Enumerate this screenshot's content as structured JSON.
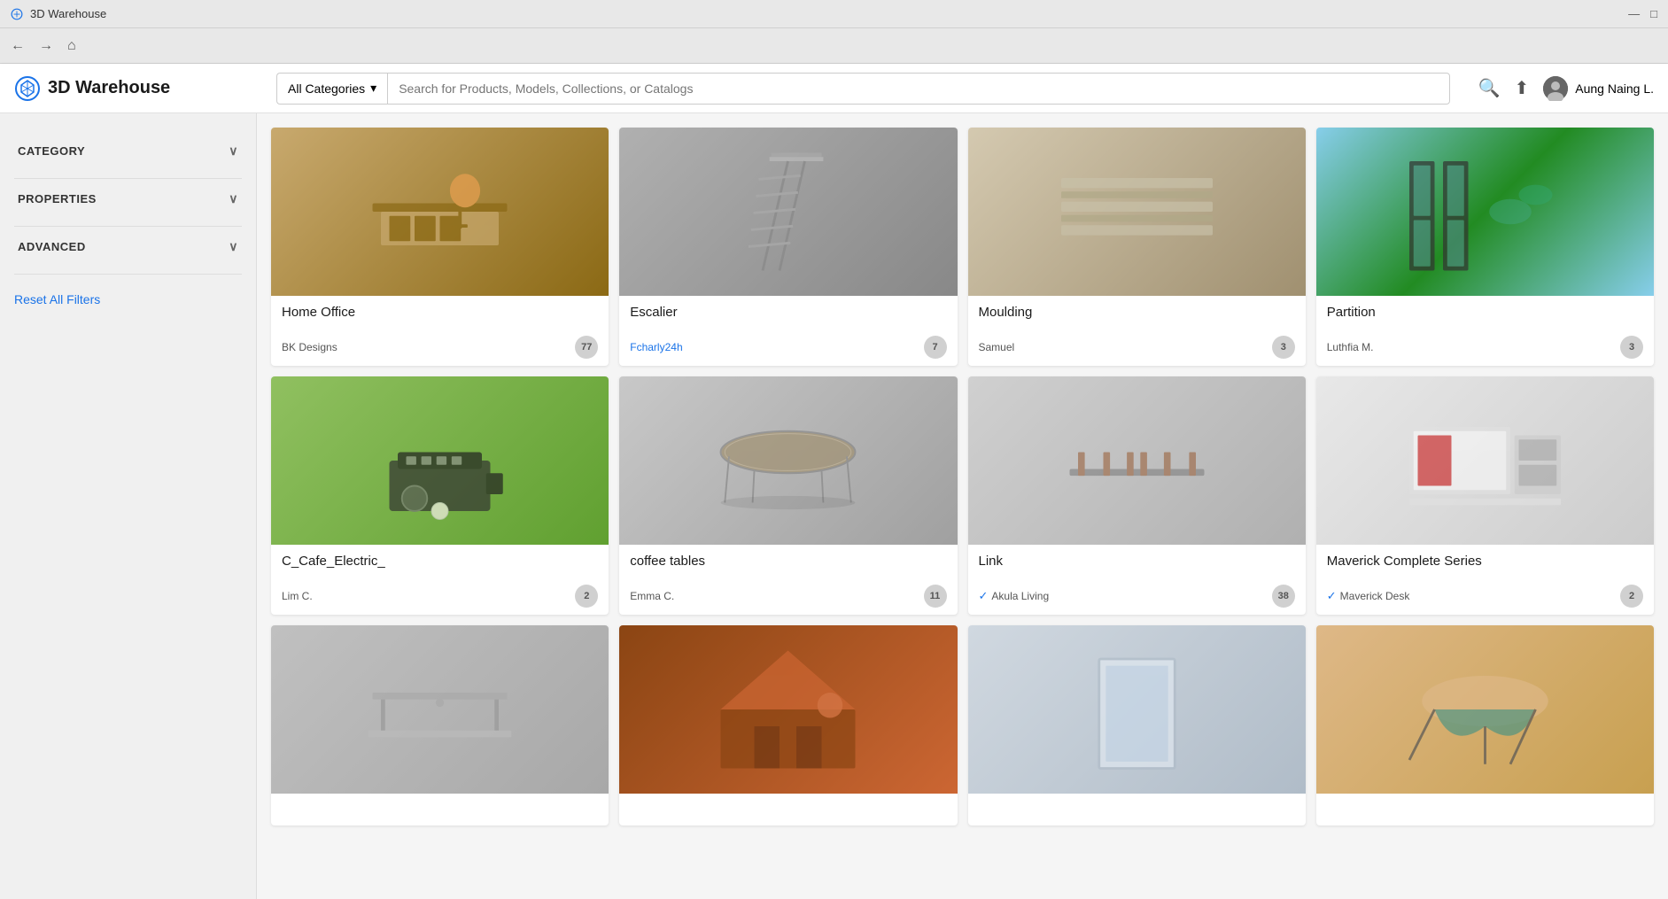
{
  "titlebar": {
    "title": "3D Warehouse",
    "min_btn": "—",
    "max_btn": "□"
  },
  "navbar": {
    "back": "←",
    "forward": "→",
    "home": "⌂"
  },
  "header": {
    "logo_text": "3D Warehouse",
    "category_btn": "All Categories",
    "search_placeholder": "Search for Products, Models, Collections, or Catalogs",
    "user_name": "Aung Naing L."
  },
  "sidebar": {
    "category_label": "CATEGORY",
    "properties_label": "PROPERTIES",
    "advanced_label": "ADVANCED",
    "reset_label": "Reset All Filters"
  },
  "grid": {
    "cards": [
      {
        "id": "home-office",
        "title": "Home Office",
        "author": "BK Designs",
        "count": "77",
        "verified": false,
        "verified_by": "",
        "img_class": "img-home-office"
      },
      {
        "id": "escalier",
        "title": "Escalier",
        "author": "Fcharly24h",
        "author_link": true,
        "count": "7",
        "verified": false,
        "verified_by": "",
        "img_class": "img-escalier"
      },
      {
        "id": "moulding",
        "title": "Moulding",
        "author": "Samuel",
        "count": "3",
        "verified": false,
        "verified_by": "",
        "img_class": "img-moulding"
      },
      {
        "id": "partition",
        "title": "Partition",
        "author": "Luthfia M.",
        "count": "3",
        "verified": false,
        "verified_by": "",
        "img_class": "img-partition"
      },
      {
        "id": "cafe-electric",
        "title": "C_Cafe_Electric_",
        "author": "Lim C.",
        "count": "2",
        "verified": false,
        "verified_by": "",
        "img_class": "img-cafe"
      },
      {
        "id": "coffee-tables",
        "title": "coffee tables",
        "author": "Emma C.",
        "count": "11",
        "verified": false,
        "verified_by": "",
        "img_class": "img-coffee"
      },
      {
        "id": "link",
        "title": "Link",
        "author": "Akula Living",
        "count": "38",
        "verified": true,
        "verified_by": "Akula Living",
        "img_class": "img-link"
      },
      {
        "id": "maverick",
        "title": "Maverick Complete Series",
        "author": "Maverick Desk",
        "count": "2",
        "verified": true,
        "verified_by": "Maverick Desk",
        "img_class": "img-maverick"
      },
      {
        "id": "bottom1",
        "title": "",
        "author": "",
        "count": "",
        "verified": false,
        "img_class": "img-bottom1"
      },
      {
        "id": "bottom2",
        "title": "",
        "author": "",
        "count": "",
        "verified": false,
        "img_class": "img-bottom2"
      },
      {
        "id": "bottom3",
        "title": "",
        "author": "",
        "count": "",
        "verified": false,
        "img_class": "img-bottom3"
      },
      {
        "id": "bottom4",
        "title": "",
        "author": "",
        "count": "",
        "verified": false,
        "img_class": "img-bottom4"
      }
    ]
  }
}
